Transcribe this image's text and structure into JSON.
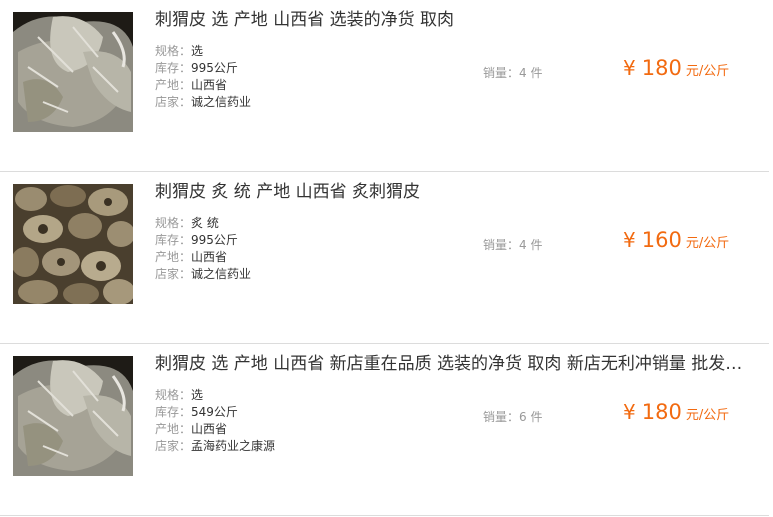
{
  "items": [
    {
      "title": "刺猬皮 选 产地 山西省 选装的净货 取肉",
      "specs": [
        {
          "key": "规格：",
          "value": "选"
        },
        {
          "key": "库存：",
          "value": "995公斤"
        },
        {
          "key": "产地：",
          "value": "山西省"
        },
        {
          "key": "店家：",
          "value": "诚之信药业"
        }
      ],
      "sales_label": "销量：",
      "sales_count": "4",
      "sales_unit": "件",
      "currency": "¥",
      "price": "180",
      "price_unit": "元/公斤",
      "image_icon": "hedgehog-skin-whole-photo"
    },
    {
      "title": "刺猬皮 炙 统 产地 山西省 炙刺猬皮",
      "specs": [
        {
          "key": "规格：",
          "value": "炙 统"
        },
        {
          "key": "库存：",
          "value": "995公斤"
        },
        {
          "key": "产地：",
          "value": "山西省"
        },
        {
          "key": "店家：",
          "value": "诚之信药业"
        }
      ],
      "sales_label": "销量：",
      "sales_count": "4",
      "sales_unit": "件",
      "currency": "¥",
      "price": "160",
      "price_unit": "元/公斤",
      "image_icon": "roasted-hedgehog-skin-pieces-photo"
    },
    {
      "title": "刺猬皮 选 产地 山西省 新店重在品质 选装的净货 取肉 新店无利冲销量 批发…",
      "specs": [
        {
          "key": "规格：",
          "value": "选"
        },
        {
          "key": "库存：",
          "value": "549公斤"
        },
        {
          "key": "产地：",
          "value": "山西省"
        },
        {
          "key": "店家：",
          "value": "孟海药业之康源"
        }
      ],
      "sales_label": "销量：",
      "sales_count": "6",
      "sales_unit": "件",
      "currency": "¥",
      "price": "180",
      "price_unit": "元/公斤",
      "image_icon": "hedgehog-skin-whole-photo"
    }
  ],
  "colors": {
    "price": "#f26a10",
    "muted": "#999999",
    "divider": "#dcdcdc"
  }
}
